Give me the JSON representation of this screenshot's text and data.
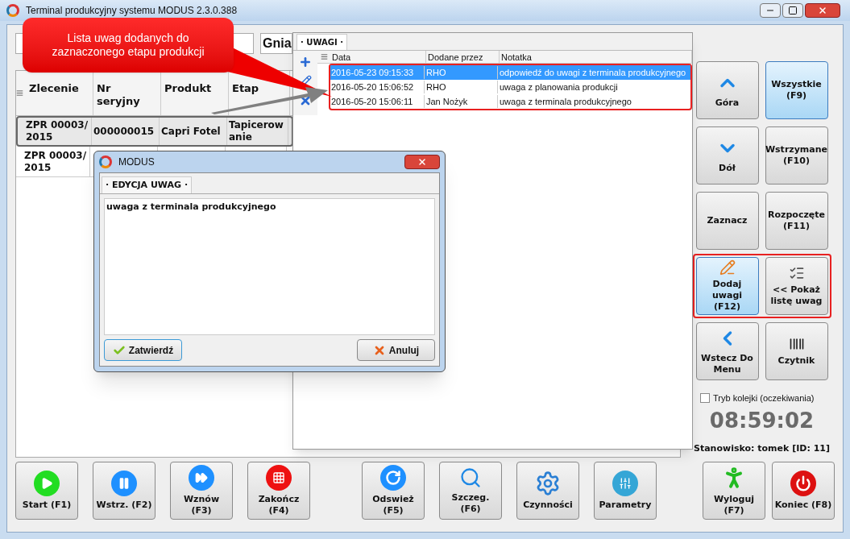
{
  "window": {
    "title": "Terminal produkcyjny systemu MODUS 2.3.0.388"
  },
  "toolbar": {
    "heading": "Gnia"
  },
  "table": {
    "columns": [
      "Zlecenie",
      "Nr seryjny",
      "Produkt",
      "Etap"
    ],
    "rows": [
      {
        "cells": [
          "ZPR 00003/2015",
          "000000015",
          "Capri Fotel",
          "Tapicerowanie"
        ],
        "selected": true
      },
      {
        "cells": [
          "ZPR 00003/2015"
        ],
        "selected": false
      }
    ]
  },
  "callout": {
    "text": "Lista uwag dodanych do zaznaczonego etapu produkcji"
  },
  "notes_panel": {
    "tab": "· UWAGI ·",
    "columns": [
      "Data",
      "Dodane przez",
      "Notatka"
    ],
    "rows_highlighted": true,
    "rows": [
      {
        "date": "2016-05-23 09:15:33",
        "author": "RHO",
        "note": "odpowiedź do uwagi z terminala produkcyjnego",
        "selected": true
      },
      {
        "date": "2016-05-20 15:06:52",
        "author": "RHO",
        "note": "uwaga z planowania produkcji",
        "selected": false
      },
      {
        "date": "2016-05-20 15:06:11",
        "author": "Jan Nożyk",
        "note": "uwaga z terminala produkcyjnego",
        "selected": false
      }
    ]
  },
  "dialog": {
    "title": "MODUS",
    "tab": "· EDYCJA UWAG ·",
    "value": "uwaga z terminala produkcyjnego",
    "buttons": [
      {
        "label": "Zatwierdź",
        "kind": "confirm"
      },
      {
        "label": "Anuluj",
        "kind": "cancel"
      }
    ]
  },
  "side_buttons": [
    {
      "highlighted": false,
      "buttons": [
        {
          "label": "Góra",
          "kind": "up",
          "active": false
        },
        {
          "label": "Wszystkie (F9)",
          "kind": "text",
          "active": true
        }
      ]
    },
    {
      "highlighted": false,
      "buttons": [
        {
          "label": "Dół",
          "kind": "down",
          "active": false
        },
        {
          "label": "Wstrzymane (F10)",
          "kind": "text",
          "active": false
        }
      ]
    },
    {
      "highlighted": false,
      "buttons": [
        {
          "label": "Zaznacz",
          "kind": "text",
          "active": false
        },
        {
          "label": "Rozpoczęte (F11)",
          "kind": "text",
          "active": false
        }
      ]
    },
    {
      "highlighted": true,
      "buttons": [
        {
          "label": "Dodaj uwagi (F12)",
          "kind": "pencil",
          "active": true
        },
        {
          "label": "<< Pokaż listę uwag",
          "kind": "list",
          "active": false
        }
      ]
    },
    {
      "highlighted": false,
      "buttons": [
        {
          "label": "Wstecz Do Menu",
          "kind": "back",
          "active": false
        },
        {
          "label": "Czytnik",
          "kind": "barcode",
          "active": false
        }
      ]
    }
  ],
  "queue_mode": {
    "label": "Tryb kolejki (oczekiwania)",
    "checked": false
  },
  "clock": "08:59:02",
  "station": "Stanowisko: tomek [ID: 11]",
  "actions": [
    {
      "label": "Start (F1)",
      "kind": "play"
    },
    {
      "label": "Wstrz. (F2)",
      "kind": "pause"
    },
    {
      "label": "Wznów (F3)",
      "kind": "forward"
    },
    {
      "label": "Zakończ (F4)",
      "kind": "grid"
    }
  ],
  "tools": [
    {
      "label": "Odswież (F5)",
      "kind": "refresh"
    },
    {
      "label": "Szczeg. (F6)",
      "kind": "search"
    },
    {
      "label": "Czynności",
      "kind": "gear"
    },
    {
      "label": "Parametry",
      "kind": "sliders"
    }
  ],
  "exit_buttons": [
    {
      "label": "Wyloguj (F7)",
      "kind": "run"
    },
    {
      "label": "Koniec (F8)",
      "kind": "power"
    }
  ]
}
